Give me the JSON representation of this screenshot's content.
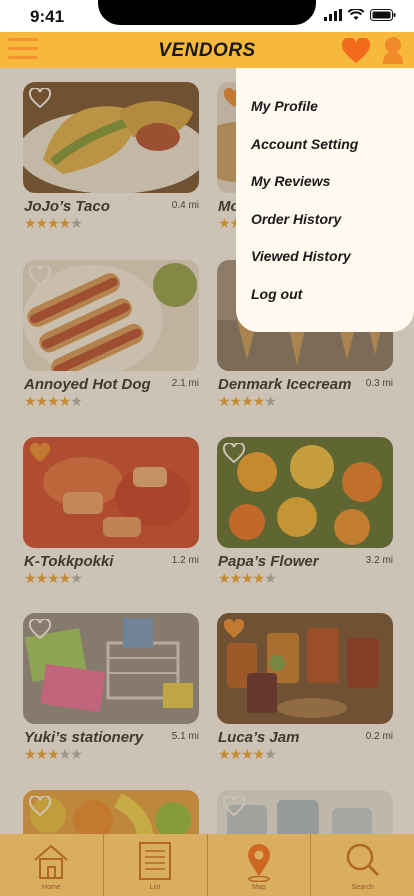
{
  "status_bar": {
    "time": "9:41"
  },
  "header": {
    "title": "VENDORS"
  },
  "vendors": [
    {
      "name": "JoJo’s Taco",
      "distance": "0.4 mi",
      "rating": 4
    },
    {
      "name": "Mo",
      "distance": "",
      "rating": 4
    },
    {
      "name": "Annoyed Hot Dog",
      "distance": "2.1 mi",
      "rating": 4.5
    },
    {
      "name": "Denmark Icecream",
      "distance": "0.3 mi",
      "rating": 4
    },
    {
      "name": "K-Tokkpokki",
      "distance": "1.2 mi",
      "rating": 4
    },
    {
      "name": "Papa’s Flower",
      "distance": "3.2 mi",
      "rating": 4
    },
    {
      "name": "Yuki’s stationery",
      "distance": "5.1 mi",
      "rating": 3
    },
    {
      "name": "Luca’s Jam",
      "distance": "0.2 mi",
      "rating": 4
    },
    {
      "name": "",
      "distance": "",
      "rating": 0
    },
    {
      "name": "",
      "distance": "",
      "rating": 0
    }
  ],
  "dropdown": {
    "items": [
      "My Profile",
      "Account Setting",
      "My Reviews",
      "Order History",
      "Viewed History",
      "Log out"
    ]
  },
  "tabs": [
    {
      "label": "Home",
      "icon": "home-icon"
    },
    {
      "label": "List",
      "icon": "list-icon"
    },
    {
      "label": "Map",
      "icon": "map-pin-icon"
    },
    {
      "label": "Search",
      "icon": "search-icon"
    }
  ],
  "colors": {
    "accent": "#f7b93c",
    "accent_dark": "#f08a2a",
    "star": "#f0a830",
    "tabbar": "#f7c46a"
  }
}
